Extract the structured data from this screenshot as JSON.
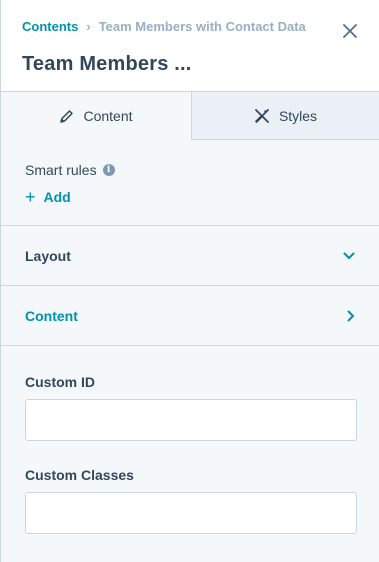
{
  "breadcrumb": {
    "root": "Contents",
    "separator": "›",
    "current": "Team Members with Contact Data"
  },
  "icons": {
    "close": "close-icon",
    "pencil": "pencil-icon",
    "styles": "styles-icon",
    "info": "info-icon",
    "plus": "plus-icon",
    "chevron_down": "chevron-down-icon",
    "chevron_right": "chevron-right-icon"
  },
  "header": {
    "title": "Team Members ..."
  },
  "tabs": [
    {
      "label": "Content",
      "active": true
    },
    {
      "label": "Styles",
      "active": false
    }
  ],
  "smart_rules": {
    "label": "Smart rules",
    "info_glyph": "i",
    "add_label": "Add",
    "add_glyph": "+"
  },
  "sections": {
    "layout_label": "Layout",
    "content_label": "Content"
  },
  "fields": {
    "custom_id": {
      "label": "Custom ID",
      "value": "",
      "placeholder": ""
    },
    "custom_classes": {
      "label": "Custom Classes",
      "value": "",
      "placeholder": ""
    }
  },
  "colors": {
    "accent": "#0091ae",
    "text": "#33475b",
    "border": "#cbd6e2",
    "background": "#f5f8fa"
  }
}
